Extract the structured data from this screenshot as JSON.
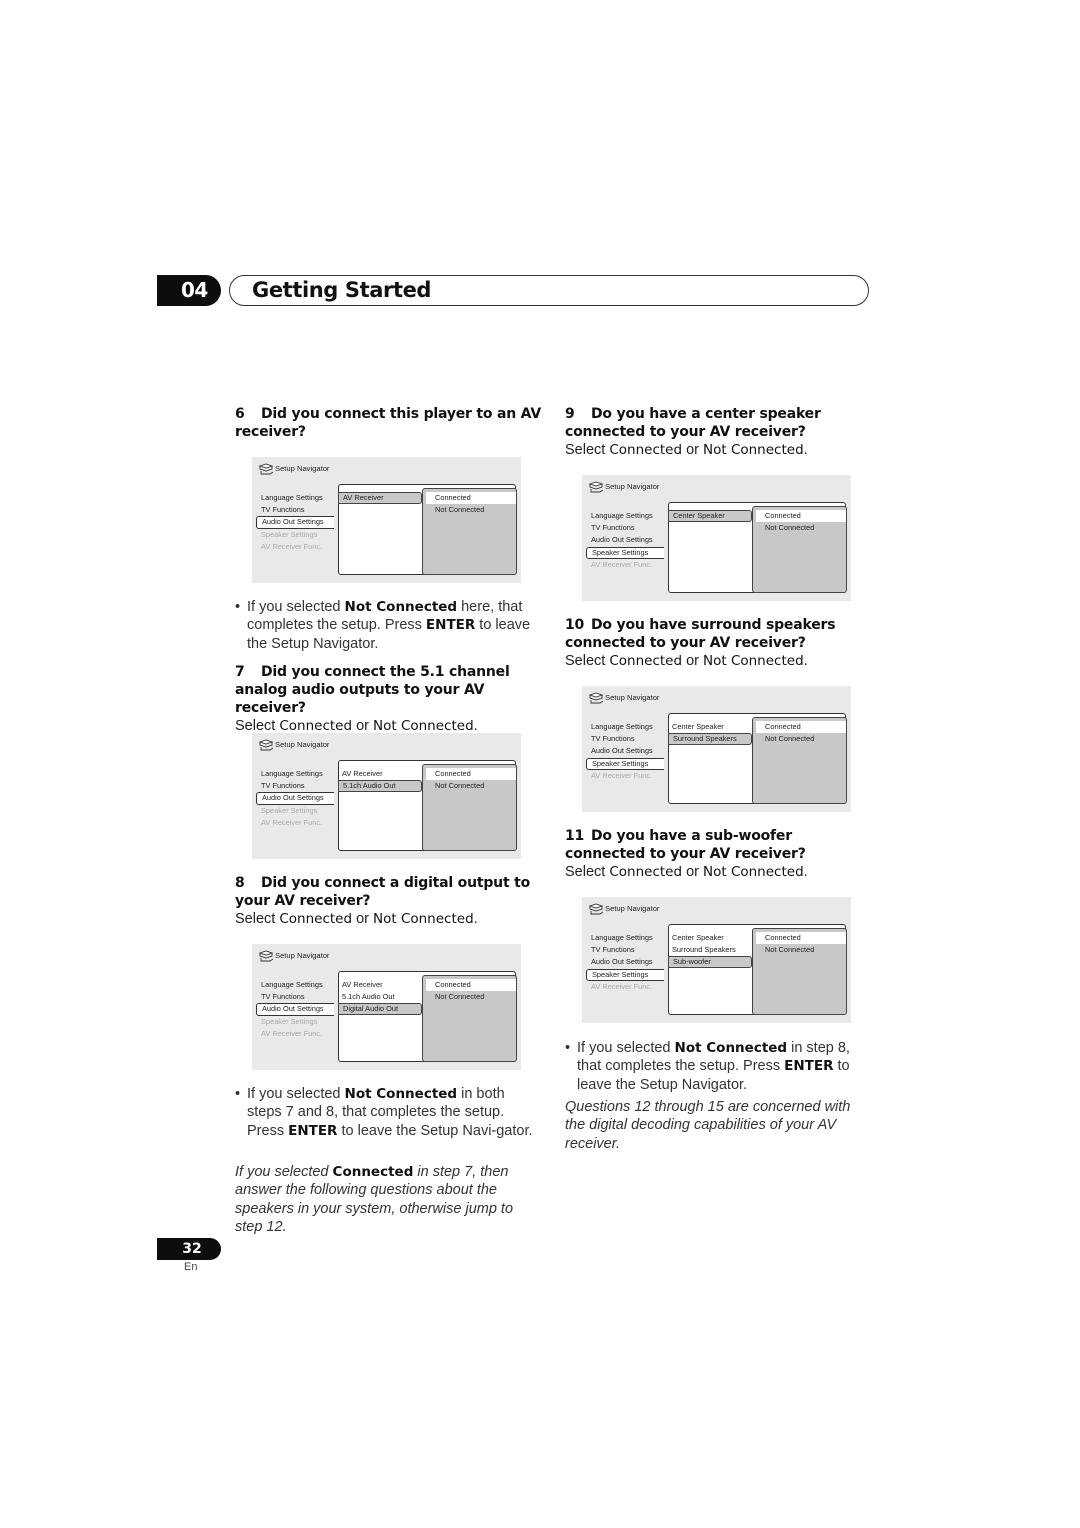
{
  "chapter": {
    "number": "04",
    "title": "Getting Started"
  },
  "common": {
    "select_prefix": "Select ",
    "connected": "Connected",
    "or": " or ",
    "not_connected": "Not Connected",
    "period": "."
  },
  "screens": {
    "title": "Setup Navigator",
    "menu": [
      "Language Settings",
      "TV Functions",
      "Audio Out Settings",
      "Speaker Settings",
      "AV Receiver Func."
    ],
    "options": [
      "Connected",
      "Not Connected"
    ],
    "s6": {
      "submenu": [
        "AV Receiver"
      ]
    },
    "s7": {
      "submenu": [
        "AV Receiver",
        "5.1ch Audio Out"
      ]
    },
    "s8": {
      "submenu": [
        "AV Receiver",
        "5.1ch Audio Out",
        "Digital Audio Out"
      ]
    },
    "s9": {
      "submenu": [
        "Center Speaker"
      ]
    },
    "s10": {
      "submenu": [
        "Center Speaker",
        "Surround Speakers"
      ]
    },
    "s11": {
      "submenu": [
        "Center Speaker",
        "Surround Speakers",
        "Sub-woofer"
      ]
    }
  },
  "steps": {
    "q6": {
      "num": "6",
      "text": "Did you connect this player to an AV receiver?"
    },
    "b6": {
      "p1": "If you selected ",
      "b1": "Not Connected",
      "p2": " here, that completes the setup. Press ",
      "b2": "ENTER",
      "p3": " to leave the Setup Navigator."
    },
    "q7": {
      "num": "7",
      "text": "Did you connect the 5.1 channel analog audio outputs to your AV receiver?"
    },
    "q8": {
      "num": "8",
      "text": "Did you connect a digital output to your AV receiver?"
    },
    "b8": {
      "p1": "If you selected ",
      "b1": "Not Connected",
      "p2": " in both steps 7 and 8, that completes the setup. Press ",
      "b2": "ENTER",
      "p3": " to leave the Setup Navi-gator."
    },
    "n8": {
      "p1": "If you selected ",
      "b1": "Connected",
      "p2": " in step 7, then answer the following questions about the speakers in your system, otherwise jump to step 12."
    },
    "q9": {
      "num": "9",
      "text": "Do you have a center speaker connected to your AV receiver?"
    },
    "q10": {
      "num": "10",
      "text": "Do you have surround speakers connected to your AV receiver?"
    },
    "q11": {
      "num": "11",
      "text": "Do you have a sub-woofer connected to your AV receiver?"
    },
    "b11": {
      "p1": "If you selected ",
      "b1": "Not Connected",
      "p2": " in step 8, that completes the setup. Press ",
      "b2": "ENTER",
      "p3": " to leave the Setup Navigator."
    },
    "n11": {
      "text": "Questions 12 through 15 are concerned with the digital decoding capabilities of your AV receiver."
    }
  },
  "footer": {
    "page": "32",
    "lang": "En"
  }
}
